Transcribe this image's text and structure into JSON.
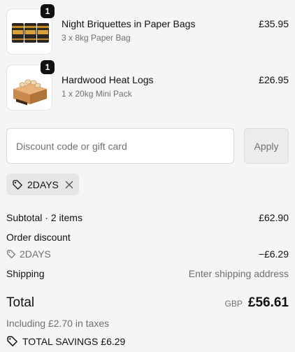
{
  "line_items": [
    {
      "title": "Night Briquettes in Paper Bags",
      "variant": "3 x 8kg Paper Bag",
      "price": "£35.95",
      "quantity": "1",
      "image_icon": "briquette-bags-image"
    },
    {
      "title": "Hardwood Heat Logs",
      "variant": "1 x 20kg Mini Pack",
      "price": "£26.95",
      "quantity": "1",
      "image_icon": "heat-logs-box-image"
    }
  ],
  "discount": {
    "placeholder": "Discount code or gift card",
    "apply_label": "Apply",
    "applied_code": "2DAYS"
  },
  "summary": {
    "subtotal_label": "Subtotal · 2 items",
    "subtotal_value": "£62.90",
    "order_discount_label": "Order discount",
    "discount_code": "2DAYS",
    "discount_value": "−£6.29",
    "shipping_label": "Shipping",
    "shipping_value": "Enter shipping address",
    "total_label": "Total",
    "total_currency": "GBP",
    "total_value": "£56.61",
    "taxes_note": "Including £2.70 in taxes",
    "total_savings": "TOTAL SAVINGS £6.29"
  },
  "colors": {
    "background": "#f5f5f5",
    "badge": "#111111",
    "muted_text": "#707070",
    "chip_background": "#e6e6e6"
  }
}
